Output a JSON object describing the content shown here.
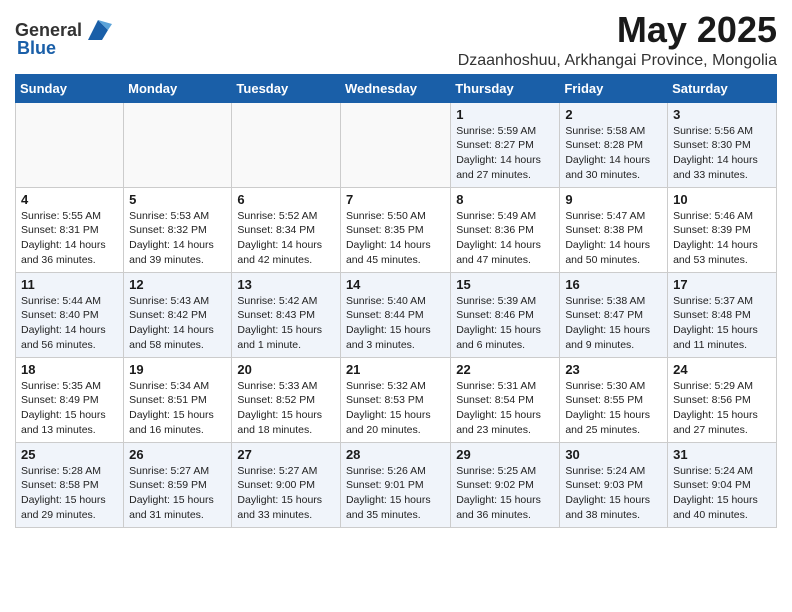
{
  "header": {
    "logo_general": "General",
    "logo_blue": "Blue",
    "month_title": "May 2025",
    "location": "Dzaanhoshuu, Arkhangai Province, Mongolia"
  },
  "days_of_week": [
    "Sunday",
    "Monday",
    "Tuesday",
    "Wednesday",
    "Thursday",
    "Friday",
    "Saturday"
  ],
  "weeks": [
    [
      {
        "day": "",
        "info": ""
      },
      {
        "day": "",
        "info": ""
      },
      {
        "day": "",
        "info": ""
      },
      {
        "day": "",
        "info": ""
      },
      {
        "day": "1",
        "info": "Sunrise: 5:59 AM\nSunset: 8:27 PM\nDaylight: 14 hours\nand 27 minutes."
      },
      {
        "day": "2",
        "info": "Sunrise: 5:58 AM\nSunset: 8:28 PM\nDaylight: 14 hours\nand 30 minutes."
      },
      {
        "day": "3",
        "info": "Sunrise: 5:56 AM\nSunset: 8:30 PM\nDaylight: 14 hours\nand 33 minutes."
      }
    ],
    [
      {
        "day": "4",
        "info": "Sunrise: 5:55 AM\nSunset: 8:31 PM\nDaylight: 14 hours\nand 36 minutes."
      },
      {
        "day": "5",
        "info": "Sunrise: 5:53 AM\nSunset: 8:32 PM\nDaylight: 14 hours\nand 39 minutes."
      },
      {
        "day": "6",
        "info": "Sunrise: 5:52 AM\nSunset: 8:34 PM\nDaylight: 14 hours\nand 42 minutes."
      },
      {
        "day": "7",
        "info": "Sunrise: 5:50 AM\nSunset: 8:35 PM\nDaylight: 14 hours\nand 45 minutes."
      },
      {
        "day": "8",
        "info": "Sunrise: 5:49 AM\nSunset: 8:36 PM\nDaylight: 14 hours\nand 47 minutes."
      },
      {
        "day": "9",
        "info": "Sunrise: 5:47 AM\nSunset: 8:38 PM\nDaylight: 14 hours\nand 50 minutes."
      },
      {
        "day": "10",
        "info": "Sunrise: 5:46 AM\nSunset: 8:39 PM\nDaylight: 14 hours\nand 53 minutes."
      }
    ],
    [
      {
        "day": "11",
        "info": "Sunrise: 5:44 AM\nSunset: 8:40 PM\nDaylight: 14 hours\nand 56 minutes."
      },
      {
        "day": "12",
        "info": "Sunrise: 5:43 AM\nSunset: 8:42 PM\nDaylight: 14 hours\nand 58 minutes."
      },
      {
        "day": "13",
        "info": "Sunrise: 5:42 AM\nSunset: 8:43 PM\nDaylight: 15 hours\nand 1 minute."
      },
      {
        "day": "14",
        "info": "Sunrise: 5:40 AM\nSunset: 8:44 PM\nDaylight: 15 hours\nand 3 minutes."
      },
      {
        "day": "15",
        "info": "Sunrise: 5:39 AM\nSunset: 8:46 PM\nDaylight: 15 hours\nand 6 minutes."
      },
      {
        "day": "16",
        "info": "Sunrise: 5:38 AM\nSunset: 8:47 PM\nDaylight: 15 hours\nand 9 minutes."
      },
      {
        "day": "17",
        "info": "Sunrise: 5:37 AM\nSunset: 8:48 PM\nDaylight: 15 hours\nand 11 minutes."
      }
    ],
    [
      {
        "day": "18",
        "info": "Sunrise: 5:35 AM\nSunset: 8:49 PM\nDaylight: 15 hours\nand 13 minutes."
      },
      {
        "day": "19",
        "info": "Sunrise: 5:34 AM\nSunset: 8:51 PM\nDaylight: 15 hours\nand 16 minutes."
      },
      {
        "day": "20",
        "info": "Sunrise: 5:33 AM\nSunset: 8:52 PM\nDaylight: 15 hours\nand 18 minutes."
      },
      {
        "day": "21",
        "info": "Sunrise: 5:32 AM\nSunset: 8:53 PM\nDaylight: 15 hours\nand 20 minutes."
      },
      {
        "day": "22",
        "info": "Sunrise: 5:31 AM\nSunset: 8:54 PM\nDaylight: 15 hours\nand 23 minutes."
      },
      {
        "day": "23",
        "info": "Sunrise: 5:30 AM\nSunset: 8:55 PM\nDaylight: 15 hours\nand 25 minutes."
      },
      {
        "day": "24",
        "info": "Sunrise: 5:29 AM\nSunset: 8:56 PM\nDaylight: 15 hours\nand 27 minutes."
      }
    ],
    [
      {
        "day": "25",
        "info": "Sunrise: 5:28 AM\nSunset: 8:58 PM\nDaylight: 15 hours\nand 29 minutes."
      },
      {
        "day": "26",
        "info": "Sunrise: 5:27 AM\nSunset: 8:59 PM\nDaylight: 15 hours\nand 31 minutes."
      },
      {
        "day": "27",
        "info": "Sunrise: 5:27 AM\nSunset: 9:00 PM\nDaylight: 15 hours\nand 33 minutes."
      },
      {
        "day": "28",
        "info": "Sunrise: 5:26 AM\nSunset: 9:01 PM\nDaylight: 15 hours\nand 35 minutes."
      },
      {
        "day": "29",
        "info": "Sunrise: 5:25 AM\nSunset: 9:02 PM\nDaylight: 15 hours\nand 36 minutes."
      },
      {
        "day": "30",
        "info": "Sunrise: 5:24 AM\nSunset: 9:03 PM\nDaylight: 15 hours\nand 38 minutes."
      },
      {
        "day": "31",
        "info": "Sunrise: 5:24 AM\nSunset: 9:04 PM\nDaylight: 15 hours\nand 40 minutes."
      }
    ]
  ]
}
